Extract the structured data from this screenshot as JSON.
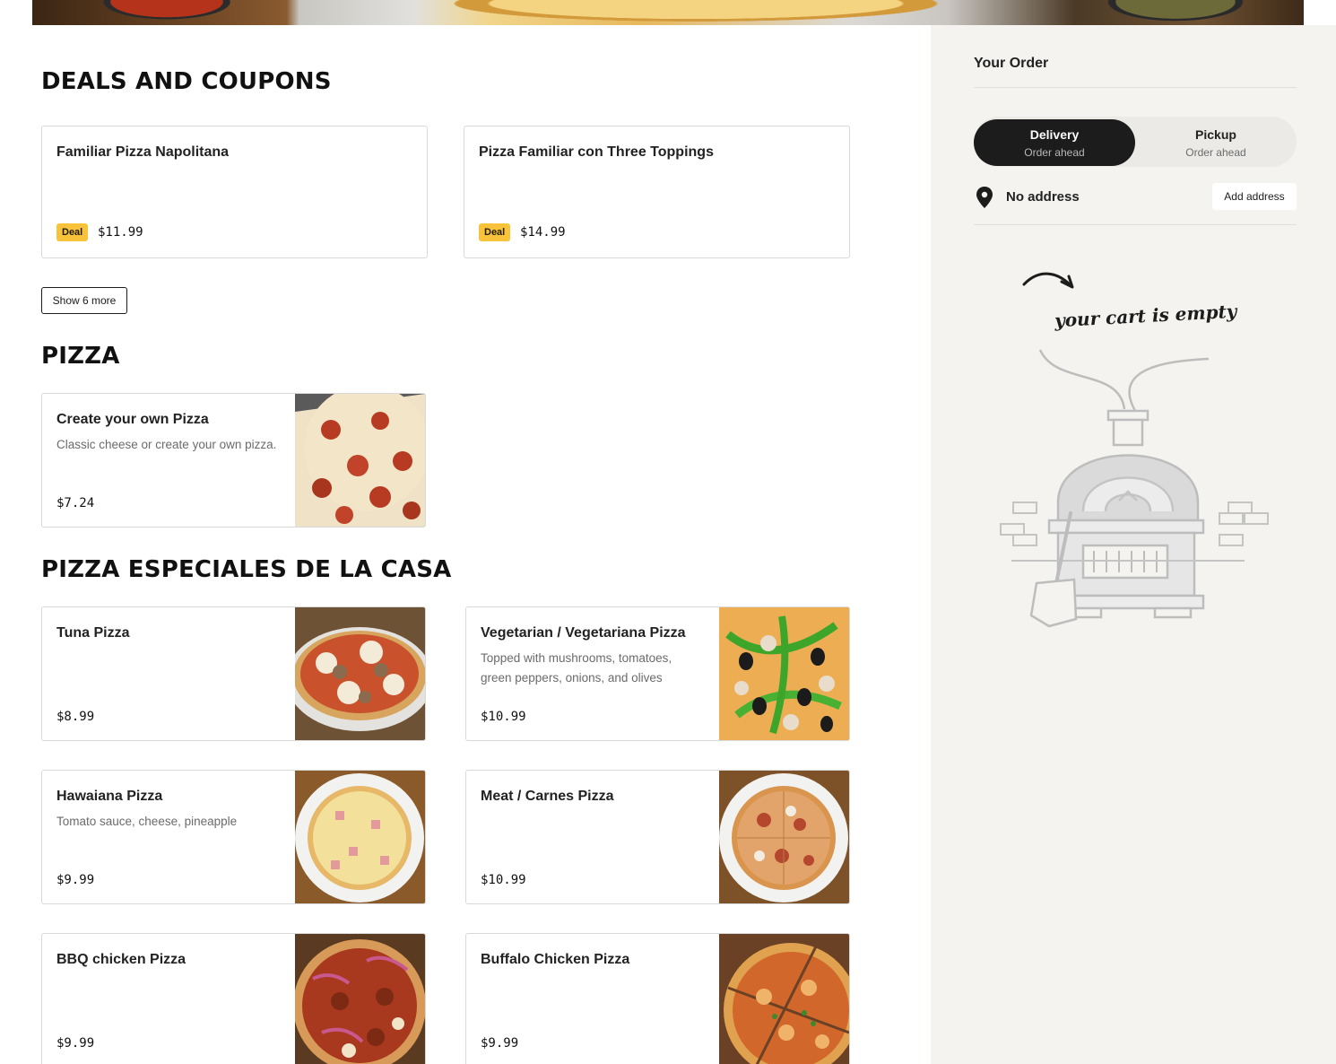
{
  "sections": {
    "deals": {
      "title": "DEALS AND COUPONS",
      "cards": [
        {
          "title": "Familiar Pizza Napolitana",
          "badge": "Deal",
          "price": "$11.99"
        },
        {
          "title": "Pizza Familiar con Three Toppings",
          "badge": "Deal",
          "price": "$14.99"
        }
      ],
      "show_more_label": "Show 6 more"
    },
    "pizza": {
      "title": "PIZZA",
      "items": [
        {
          "name": "Create your own Pizza",
          "description": "Classic cheese or create your own pizza.",
          "price": "$7.24"
        }
      ]
    },
    "especiales": {
      "title": "PIZZA ESPECIALES DE LA CASA",
      "items": [
        {
          "name": "Tuna Pizza",
          "description": "",
          "price": "$8.99"
        },
        {
          "name": "Vegetarian / Vegetariana Pizza",
          "description": "Topped with mushrooms, tomatoes, green peppers, onions, and olives",
          "price": "$10.99"
        },
        {
          "name": "Hawaiana Pizza",
          "description": "Tomato sauce, cheese, pineapple",
          "price": "$9.99"
        },
        {
          "name": "Meat / Carnes Pizza",
          "description": "",
          "price": "$10.99"
        },
        {
          "name": "BBQ chicken Pizza",
          "description": "",
          "price": "$9.99"
        },
        {
          "name": "Buffalo Chicken Pizza",
          "description": "",
          "price": "$9.99"
        }
      ]
    }
  },
  "order": {
    "title": "Your Order",
    "modes": [
      {
        "label": "Delivery",
        "sub": "Order ahead",
        "active": true
      },
      {
        "label": "Pickup",
        "sub": "Order ahead",
        "active": false
      }
    ],
    "address": "No address",
    "add_address_label": "Add address",
    "empty_message": "your cart is empty"
  },
  "icons": {
    "pin": "map-pin-icon",
    "arrow": "curved-arrow-icon"
  },
  "colors": {
    "deal_badge": "#f8c33a",
    "active_toggle": "#1c1c1c",
    "sidebar_bg": "#f4f3f0"
  }
}
